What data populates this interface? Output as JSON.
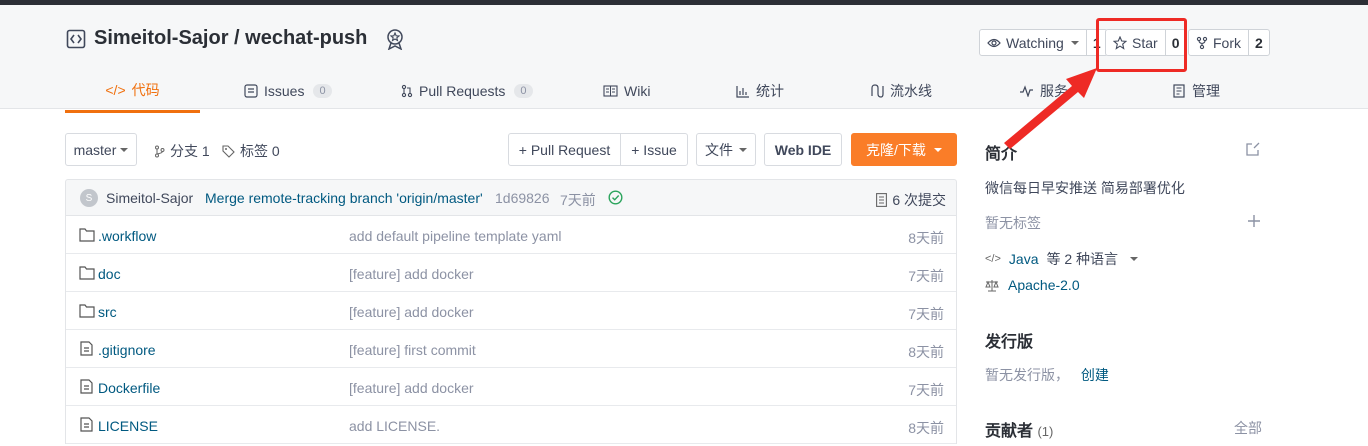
{
  "repo": {
    "title": "Simeitol-Sajor / wechat-push"
  },
  "actions": {
    "watch": {
      "label": "Watching",
      "count": "1"
    },
    "star": {
      "label": "Star",
      "count": "0"
    },
    "fork": {
      "label": "Fork",
      "count": "2"
    }
  },
  "tabs": [
    {
      "label": "代码",
      "icon": "code-icon",
      "active": true
    },
    {
      "label": "Issues",
      "count": "0",
      "icon": "issues-icon"
    },
    {
      "label": "Pull Requests",
      "count": "0",
      "icon": "pull-request-icon"
    },
    {
      "label": "Wiki",
      "icon": "wiki-icon"
    },
    {
      "label": "统计",
      "icon": "stats-icon"
    },
    {
      "label": "流水线",
      "icon": "pipeline-icon"
    },
    {
      "label": "服务",
      "icon": "service-icon"
    },
    {
      "label": "管理",
      "icon": "manage-icon"
    }
  ],
  "toolbar": {
    "branch": "master",
    "branches": "分支 1",
    "tags": "标签 0",
    "pull_request": "+ Pull Request",
    "issue": "+ Issue",
    "file": "文件",
    "web_ide": "Web IDE",
    "clone": "克隆/下载"
  },
  "commit": {
    "avatar_letter": "S",
    "author": "Simeitol-Sajor",
    "message": "Merge remote-tracking branch 'origin/master'",
    "sha": "1d69826",
    "time": "7天前",
    "commits": "6 次提交"
  },
  "files": [
    {
      "name": ".workflow",
      "type": "folder",
      "message": "add default pipeline template yaml",
      "time": "8天前"
    },
    {
      "name": "doc",
      "type": "folder",
      "message": "[feature] add docker",
      "time": "7天前"
    },
    {
      "name": "src",
      "type": "folder",
      "message": "[feature] add docker",
      "time": "7天前"
    },
    {
      "name": ".gitignore",
      "type": "file",
      "message": "[feature] first commit",
      "time": "8天前"
    },
    {
      "name": "Dockerfile",
      "type": "file",
      "message": "[feature] add docker",
      "time": "7天前"
    },
    {
      "name": "LICENSE",
      "type": "file",
      "message": "add LICENSE.",
      "time": "8天前"
    }
  ],
  "sidebar": {
    "intro_title": "简介",
    "intro": "微信每日早安推送 简易部署优化",
    "no_tags": "暂无标签",
    "language": "Java",
    "language_suffix": "等 2 种语言",
    "license": "Apache-2.0",
    "release_title": "发行版",
    "no_release": "暂无发行版，",
    "create": "创建",
    "contrib_title": "贡献者",
    "contrib_count": "(1)",
    "all": "全部"
  },
  "colors": {
    "accent": "#f0700e",
    "clone": "#fa7d28",
    "link": "#005980",
    "annotation": "#ee2a25"
  }
}
